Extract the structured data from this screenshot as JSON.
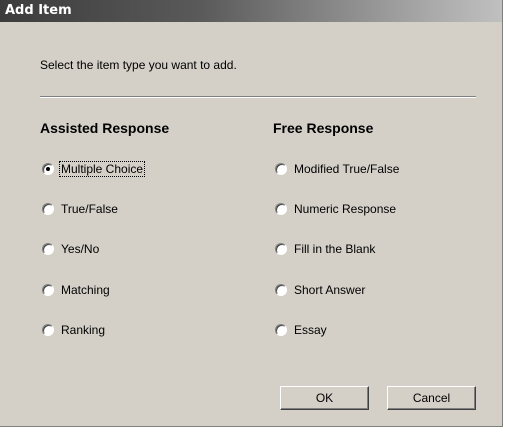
{
  "window": {
    "title": "Add Item"
  },
  "instruction": "Select the item type you want to add.",
  "assisted": {
    "heading": "Assisted Response",
    "options": [
      {
        "label": "Multiple Choice",
        "selected": true
      },
      {
        "label": "True/False",
        "selected": false
      },
      {
        "label": "Yes/No",
        "selected": false
      },
      {
        "label": "Matching",
        "selected": false
      },
      {
        "label": "Ranking",
        "selected": false
      }
    ]
  },
  "free": {
    "heading": "Free Response",
    "options": [
      {
        "label": "Modified True/False",
        "selected": false
      },
      {
        "label": "Numeric Response",
        "selected": false
      },
      {
        "label": "Fill in the Blank",
        "selected": false
      },
      {
        "label": "Short Answer",
        "selected": false
      },
      {
        "label": "Essay",
        "selected": false
      }
    ]
  },
  "buttons": {
    "ok_label": "OK",
    "cancel_label": "Cancel"
  },
  "colors": {
    "dialog_background": "#d4d0c8",
    "title_text": "#ffffff"
  }
}
